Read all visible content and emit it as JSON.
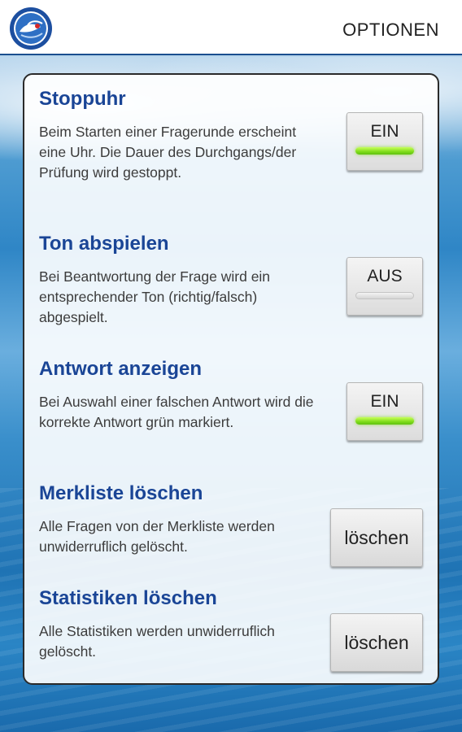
{
  "header": {
    "title": "OPTIONEN",
    "logo_icon": "app-logo-icon"
  },
  "colors": {
    "title_blue": "#1a4596",
    "toggle_on": "#7fdc1a",
    "header_border": "#1b4f8f"
  },
  "settings": {
    "stopwatch": {
      "title": "Stoppuhr",
      "description": "Beim Starten einer Fragerunde erscheint eine Uhr. Die Dauer des Durchgangs/der Prüfung wird gestoppt.",
      "state_label": "EIN",
      "state": "on"
    },
    "sound": {
      "title": "Ton abspielen",
      "description": "Bei Beantwortung der Frage wird ein entsprechender Ton (richtig/falsch) abgespielt.",
      "state_label": "AUS",
      "state": "off"
    },
    "show_answer": {
      "title": "Antwort anzeigen",
      "description": "Bei Auswahl einer falschen Antwort wird die korrekte Antwort grün markiert.",
      "state_label": "EIN",
      "state": "on"
    },
    "clear_bookmarks": {
      "title": "Merkliste löschen",
      "description": "Alle Fragen von der Merkliste werden unwiderruflich gelöscht.",
      "button_label": "löschen"
    },
    "clear_statistics": {
      "title": "Statistiken löschen",
      "description": "Alle Statistiken werden unwiderruflich gelöscht.",
      "button_label": "löschen"
    }
  }
}
